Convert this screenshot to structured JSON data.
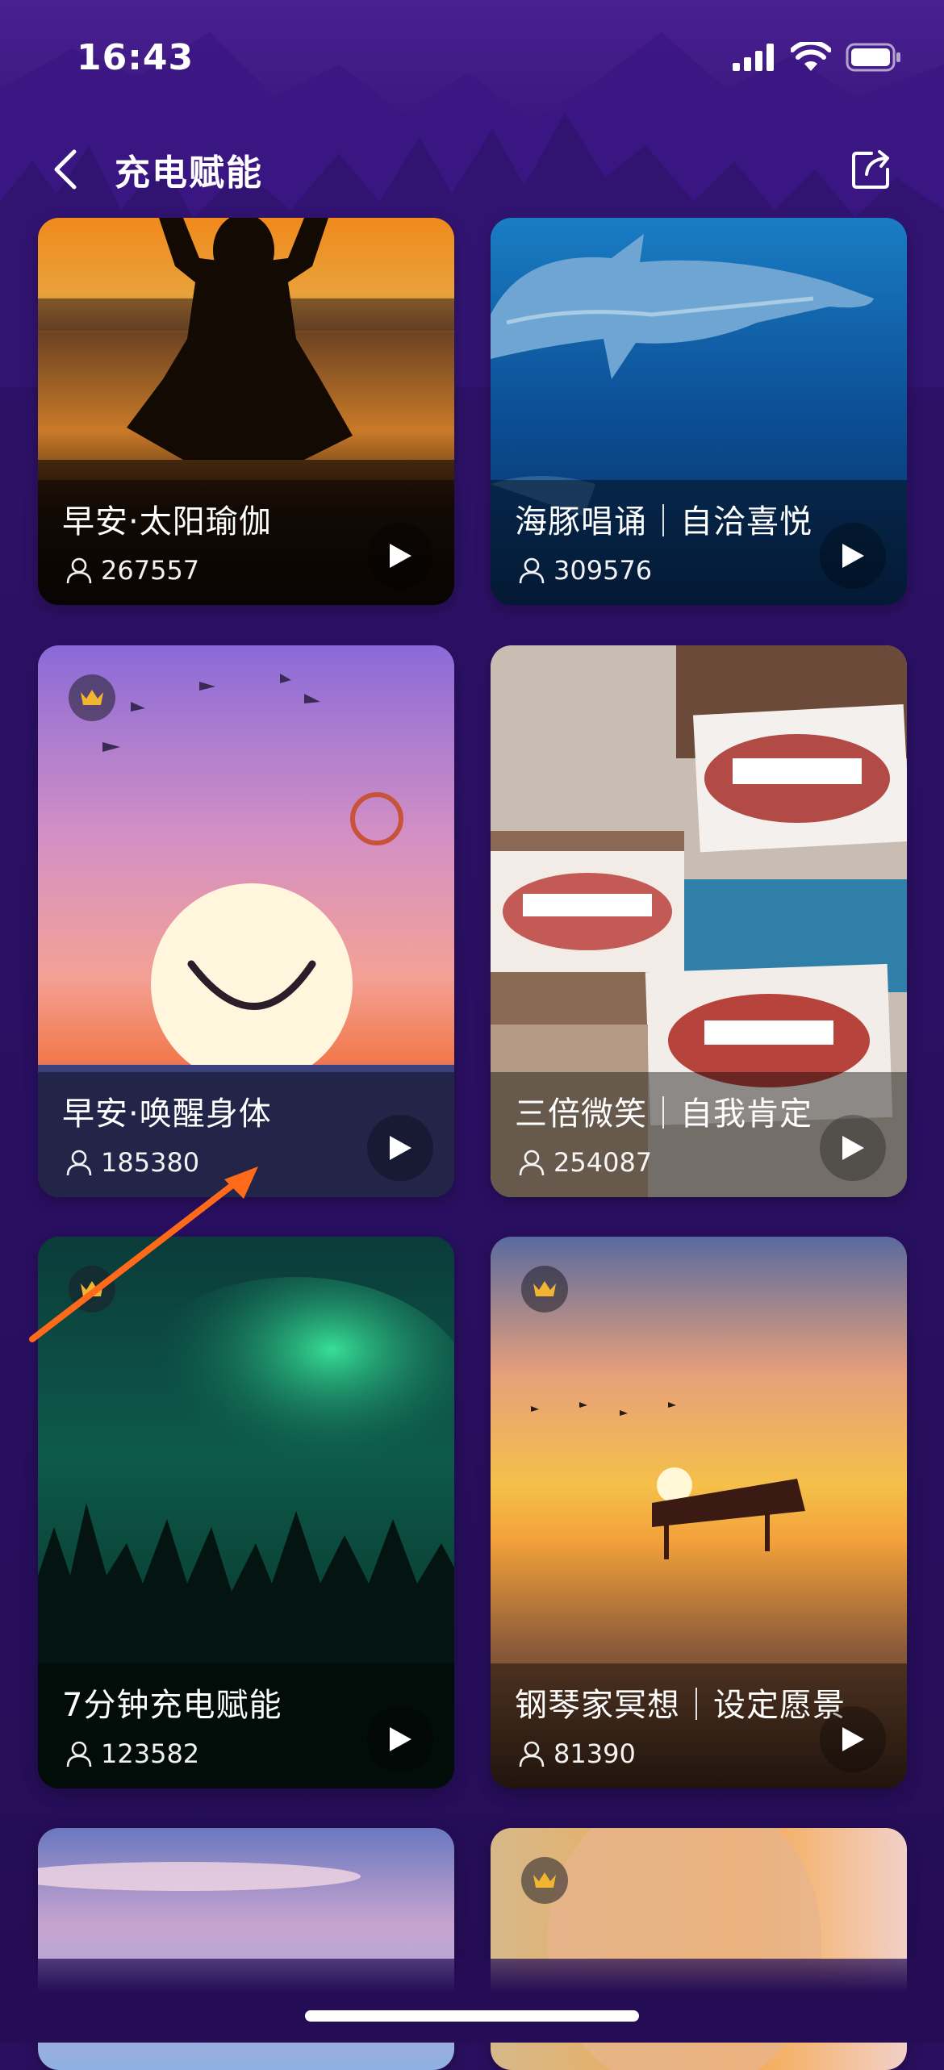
{
  "status": {
    "time": "16:43"
  },
  "nav": {
    "title": "充电赋能"
  },
  "cards": [
    {
      "title": "早安·太阳瑜伽",
      "count": "267557",
      "premium": false
    },
    {
      "title": "海豚唱诵｜自洽喜悦",
      "count": "309576",
      "premium": false
    },
    {
      "title": "早安·唤醒身体",
      "count": "185380",
      "premium": true
    },
    {
      "title": "三倍微笑｜自我肯定",
      "count": "254087",
      "premium": false
    },
    {
      "title": "7分钟充电赋能",
      "count": "123582",
      "premium": true
    },
    {
      "title": "钢琴家冥想｜设定愿景",
      "count": "81390",
      "premium": true
    }
  ],
  "colors": {
    "background": "#2a0f5f",
    "accent_arrow": "#ff6a1a",
    "crown": "#f2b531"
  },
  "icons": [
    "back-icon",
    "share-icon",
    "play-icon",
    "user-icon",
    "crown-icon",
    "signal-icon",
    "wifi-icon",
    "battery-icon"
  ]
}
